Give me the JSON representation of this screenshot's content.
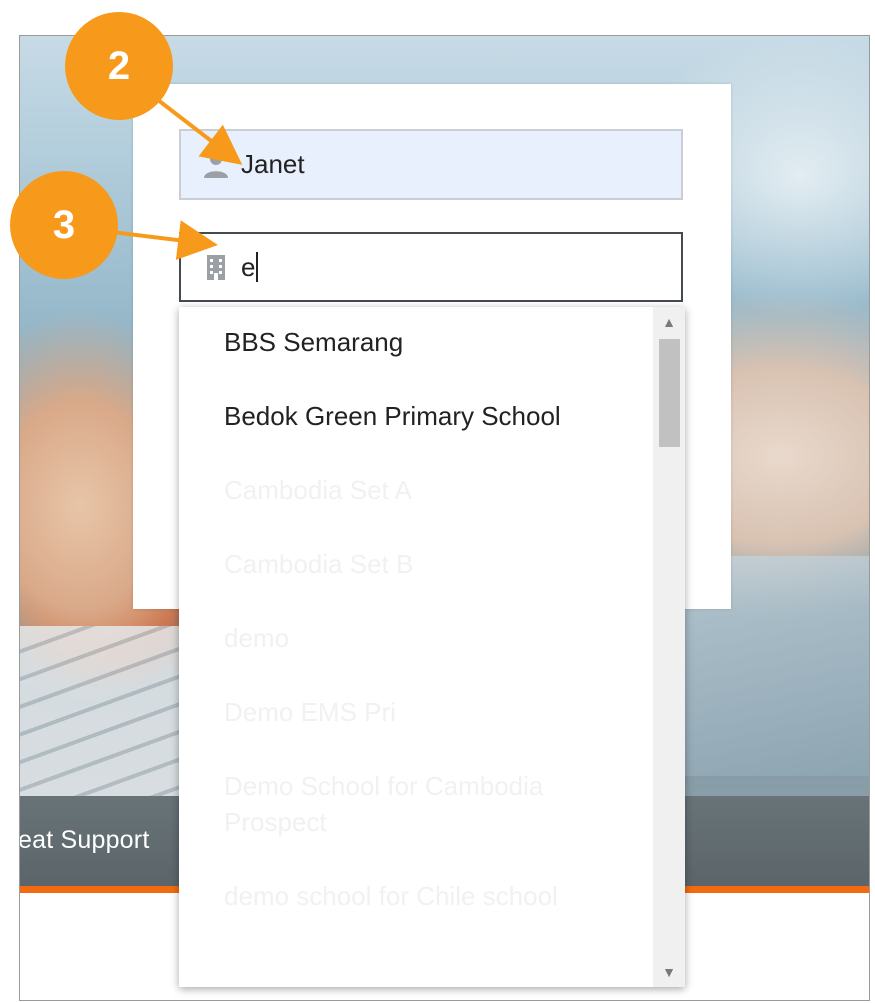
{
  "login": {
    "username_value": "Janet",
    "school_value": "e"
  },
  "dropdown": {
    "items": [
      "BBS Semarang",
      "Bedok Green Primary School",
      "Cambodia Set A",
      "Cambodia Set B",
      "demo",
      "Demo EMS Pri",
      "Demo School for Cambodia Prospect",
      "demo school for Chile school"
    ]
  },
  "background": {
    "caption": "eat Support"
  },
  "annotations": {
    "step_2": "2",
    "step_3": "3"
  },
  "icons": {
    "username": "user-icon",
    "school": "building-icon",
    "scroll_up": "chevron-up-icon",
    "scroll_down": "chevron-down-icon"
  },
  "colors": {
    "accent_orange": "#f26b10",
    "badge_orange": "#f79a1c",
    "autofill_blue": "#e8f0fe"
  }
}
